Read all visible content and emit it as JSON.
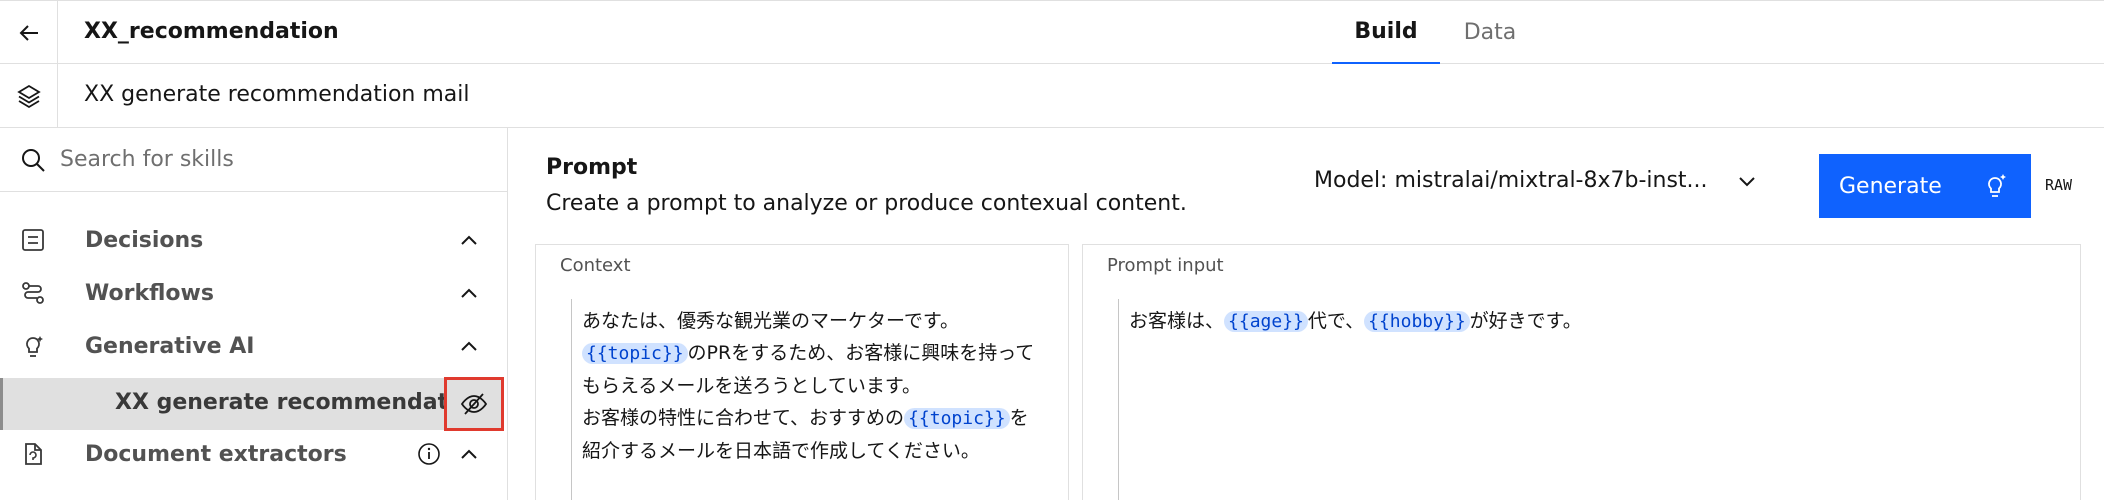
{
  "header": {
    "app_title": "XX_recommendation",
    "tabs": [
      {
        "label": "Build",
        "active": true
      },
      {
        "label": "Data",
        "active": false
      }
    ]
  },
  "subheader": {
    "skill_title": "XX generate recommendation mail"
  },
  "sidebar": {
    "search_placeholder": "Search for skills",
    "items": [
      {
        "label": "Decisions",
        "icon": "list-icon",
        "expanded": true
      },
      {
        "label": "Workflows",
        "icon": "workflow-icon",
        "expanded": true
      },
      {
        "label": "Generative AI",
        "icon": "ai-bulb-icon",
        "expanded": true
      },
      {
        "label": "Document extractors",
        "icon": "document-icon",
        "expanded": true
      }
    ],
    "selected_skill": "XX generate recommendati..."
  },
  "prompt": {
    "title": "Prompt",
    "description": "Create a prompt to analyze or produce contexual content.",
    "model_label": "Model: mistralai/mixtral-8x7b-inst...",
    "generate_label": "Generate",
    "raw_label": "RAW"
  },
  "context": {
    "label": "Context",
    "segments": [
      {
        "t": "text",
        "v": "あなたは、優秀な観光業のマーケターです。"
      },
      {
        "t": "br"
      },
      {
        "t": "var",
        "v": "{{topic}}"
      },
      {
        "t": "text",
        "v": "のPRをするため、お客様に興味を持って"
      },
      {
        "t": "br"
      },
      {
        "t": "text",
        "v": "もらえるメールを送ろうとしています。"
      },
      {
        "t": "br"
      },
      {
        "t": "text",
        "v": "お客様の特性に合わせて、おすすめの"
      },
      {
        "t": "var",
        "v": "{{topic}}"
      },
      {
        "t": "text",
        "v": "を"
      },
      {
        "t": "br"
      },
      {
        "t": "text",
        "v": "紹介するメールを日本語で作成してください。"
      }
    ]
  },
  "prompt_input": {
    "label": "Prompt input",
    "segments": [
      {
        "t": "text",
        "v": "お客様は、"
      },
      {
        "t": "var",
        "v": "{{age}}"
      },
      {
        "t": "text",
        "v": "代で、"
      },
      {
        "t": "var",
        "v": "{{hobby}}"
      },
      {
        "t": "text",
        "v": "が好きです。"
      }
    ]
  },
  "colors": {
    "accent": "#0f62fe",
    "highlight_box": "#e03a2e",
    "variable_bg": "#d0e2ff",
    "variable_text": "#0043ce"
  }
}
